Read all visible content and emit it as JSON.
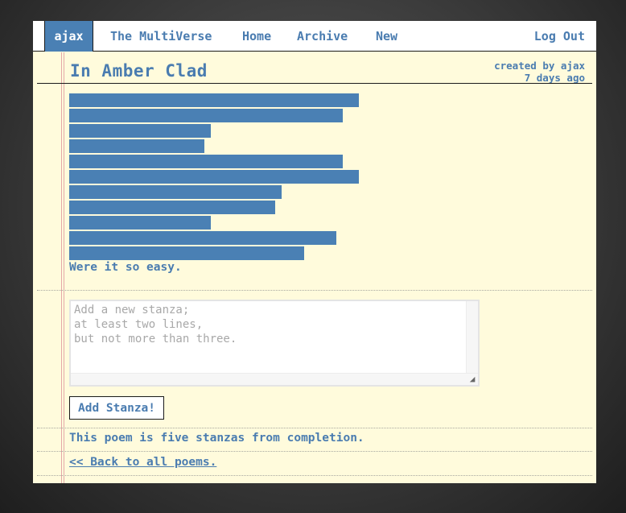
{
  "nav": {
    "user": "ajax",
    "links": [
      "The MultiVerse",
      "Home",
      "Archive",
      "New"
    ],
    "logout": "Log Out"
  },
  "poem": {
    "title": "In Amber Clad",
    "created_by": "created by ajax",
    "age": "7 days ago",
    "redacted_line_lengths": [
      0.9,
      0.85,
      0.44,
      0.42,
      0.85,
      0.9,
      0.66,
      0.64,
      0.44,
      0.83,
      0.73
    ],
    "last_line": "Were it so easy."
  },
  "stanza_form": {
    "placeholder": "Add a new stanza;\nat least two lines,\nbut not more than three.",
    "value": "",
    "submit_label": "Add Stanza!"
  },
  "status": "This poem is five stanzas from completion.",
  "back_link": "<< Back to all poems.",
  "colors": {
    "accent": "#4a80b4",
    "paper": "#fffbdc",
    "margin_line": "#e5a8a8"
  }
}
